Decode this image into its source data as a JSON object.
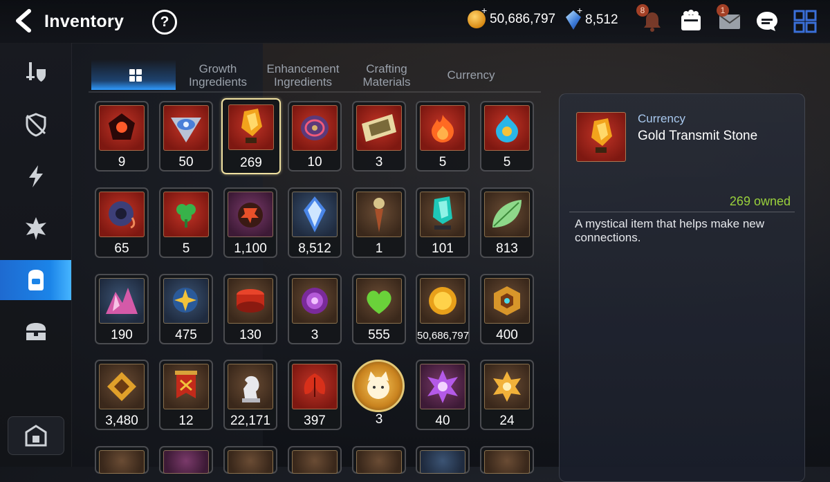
{
  "header": {
    "title": "Inventory",
    "gold": "50,686,797",
    "crystals": "8,512",
    "notifications_badge": "8",
    "mail_badge": "1"
  },
  "tabs": [
    {
      "label": "",
      "icon": "grid-icon",
      "active": true
    },
    {
      "label": "Growth Ingredients"
    },
    {
      "label": "Enhancement Ingredients"
    },
    {
      "label": "Crafting Materials"
    },
    {
      "label": "Currency"
    }
  ],
  "sidebar": {
    "items": [
      "equipment-icon",
      "artifact-icon",
      "catalyst-icon",
      "material-icon",
      "items-icon",
      "chest-icon"
    ],
    "active": "items-icon"
  },
  "items": [
    [
      "9",
      "50",
      "269",
      "10",
      "3",
      "5",
      "5"
    ],
    [
      "65",
      "5",
      "1,100",
      "8,512",
      "1",
      "101",
      "813"
    ],
    [
      "190",
      "475",
      "130",
      "3",
      "555",
      "50,686,797",
      "400"
    ],
    [
      "3,480",
      "12",
      "22,171",
      "397",
      "3",
      "40",
      "24"
    ]
  ],
  "detail": {
    "category": "Currency",
    "name": "Gold Transmit Stone",
    "owned": "269 owned",
    "description": "A mystical item that helps make new connections."
  },
  "colors": {
    "accent": "#2f9bff",
    "owned": "#9ad13c",
    "selected_border": "#efe0a0"
  }
}
